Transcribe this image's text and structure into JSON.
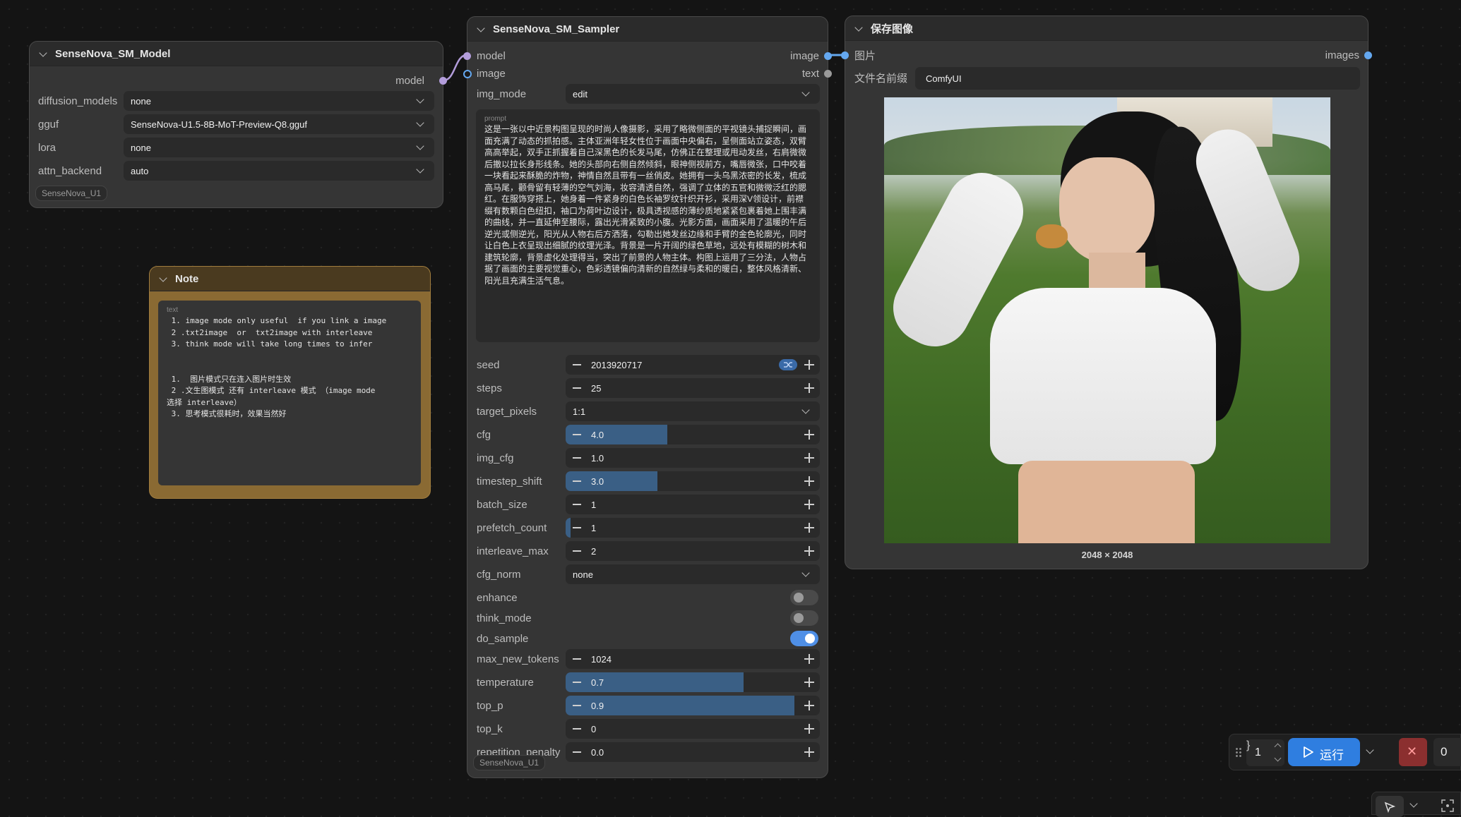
{
  "model_node": {
    "title": "SenseNova_SM_Model",
    "output_label": "model",
    "fields": [
      {
        "label": "diffusion_models",
        "value": "none"
      },
      {
        "label": "gguf",
        "value": "SenseNova-U1.5-8B-MoT-Preview-Q8.gguf"
      },
      {
        "label": "lora",
        "value": "none"
      },
      {
        "label": "attn_backend",
        "value": "auto"
      }
    ],
    "badge": "SenseNova_U1"
  },
  "note_node": {
    "title": "Note",
    "text_label": "text",
    "lines": [
      " 1. image mode only useful  if you link a image",
      " 2 .txt2image  or  txt2image with interleave",
      " 3. think mode will take long times to infer",
      "",
      "",
      " 1.  图片模式只在连入图片时生效",
      " 2 .文生图模式 还有 interleave 模式 （image mode",
      "选择 interleave）",
      " 3. 思考模式很耗时，效果当然好"
    ]
  },
  "sampler_node": {
    "title": "SenseNova_SM_Sampler",
    "inputs": [
      "model",
      "image"
    ],
    "outputs": [
      "image",
      "text"
    ],
    "img_mode": {
      "label": "img_mode",
      "value": "edit"
    },
    "prompt_label": "prompt",
    "prompt_text": "这是一张以中近景构图呈现的时尚人像摄影，采用了略微侧面的平视镜头捕捉瞬间，画面充满了动态的抓拍感。主体亚洲年轻女性位于画面中央偏右，呈侧面站立姿态，双臂高高举起，双手正抓握着自己深黑色的长发马尾，仿佛正在整理或甩动发丝，右肩微微后撤以拉长身形线条。她的头部向右侧自然倾斜，眼神侧视前方，嘴唇微张，口中咬着一块看起来酥脆的炸物，神情自然且带有一丝俏皮。她拥有一头乌黑浓密的长发，梳成高马尾，颧骨留有轻薄的空气刘海，妆容清透自然，强调了立体的五官和微微泛红的腮红。在服饰穿搭上，她身着一件紧身的白色长袖罗纹针织开衫，采用深V领设计，前襟缀有数颗白色纽扣，袖口为荷叶边设计，极具透视感的薄纱质地紧紧包裹着她上围丰满的曲线，并一直延伸至腰际，露出光滑紧致的小腹。光影方面，画面采用了温暖的午后逆光或侧逆光，阳光从人物右后方洒落，勾勒出她发丝边缘和手臂的金色轮廓光，同时让白色上衣呈现出细腻的纹理光泽。背景是一片开阔的绿色草地，远处有模糊的树木和建筑轮廓，背景虚化处理得当，突出了前景的人物主体。构图上运用了三分法，人物占据了画面的主要视觉重心，色彩透镜偏向清新的自然绿与柔和的暖白，整体风格清新、阳光且充满生活气息。",
    "numeric": [
      {
        "name": "seed",
        "label": "seed",
        "value": "2013920717",
        "fill": 0
      },
      {
        "name": "steps",
        "label": "steps",
        "value": "25",
        "fill": 0
      },
      {
        "name": "target-pixels",
        "label": "target_pixels",
        "value": "1:1",
        "select": true
      },
      {
        "name": "cfg",
        "label": "cfg",
        "value": "4.0",
        "fill": 0.4
      },
      {
        "name": "img-cfg",
        "label": "img_cfg",
        "value": "1.0",
        "fill": 0
      },
      {
        "name": "timestep-shift",
        "label": "timestep_shift",
        "value": "3.0",
        "fill": 0.36
      },
      {
        "name": "batch-size",
        "label": "batch_size",
        "value": "1",
        "fill": 0
      },
      {
        "name": "prefetch-count",
        "label": "prefetch_count",
        "value": "1",
        "fill": 0.02
      },
      {
        "name": "interleave-max",
        "label": "interleave_max",
        "value": "2",
        "fill": 0
      },
      {
        "name": "cfg-norm",
        "label": "cfg_norm",
        "value": "none",
        "select": true
      }
    ],
    "toggles": [
      {
        "name": "enhance",
        "label": "enhance",
        "on": false
      },
      {
        "name": "think-mode",
        "label": "think_mode",
        "on": false
      },
      {
        "name": "do-sample",
        "label": "do_sample",
        "on": true
      }
    ],
    "numeric2": [
      {
        "name": "max-new-tokens",
        "label": "max_new_tokens",
        "value": "1024",
        "fill": 0
      },
      {
        "name": "temperature",
        "label": "temperature",
        "value": "0.7",
        "fill": 0.7
      },
      {
        "name": "top-p",
        "label": "top_p",
        "value": "0.9",
        "fill": 0.9
      },
      {
        "name": "top-k",
        "label": "top_k",
        "value": "0",
        "fill": 0
      },
      {
        "name": "repetition-penalty",
        "label": "repetition_penalty",
        "value": "0.0",
        "fill": 0
      }
    ],
    "badge": "SenseNova_U1"
  },
  "save_node": {
    "title": "保存图像",
    "input_label": "图片",
    "output_label": "images",
    "prefix_label": "文件名前缀",
    "prefix_value": "ComfyUI",
    "image_size": "2048 × 2048"
  },
  "run_bar": {
    "count": "1",
    "run_label": "运行",
    "queue": "0"
  },
  "colors": {
    "accent": "#2f7ee0",
    "link_model": "#b39ddb",
    "link_image": "#64a8f0",
    "note_border": "#7a5a2a",
    "cancel": "#8b2f2f"
  }
}
